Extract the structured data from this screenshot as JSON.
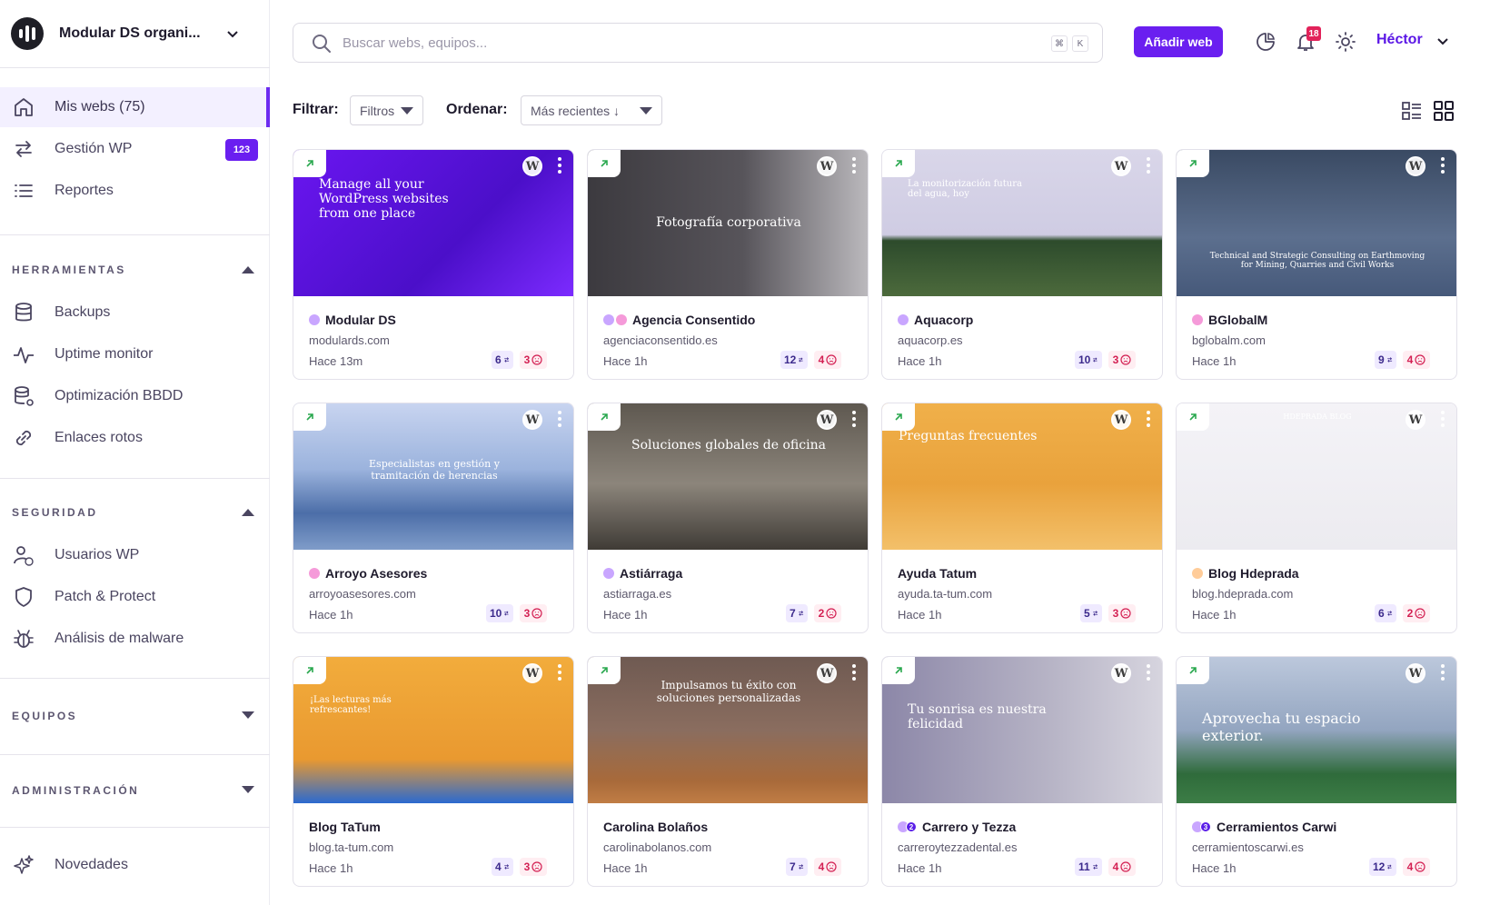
{
  "org": {
    "name": "Modular DS organi..."
  },
  "sidebar": {
    "main": [
      {
        "label": "Mis webs (75)",
        "icon": "home-icon",
        "active": true
      },
      {
        "label": "Gestión WP",
        "icon": "sync-icon",
        "badge": "123"
      },
      {
        "label": "Reportes",
        "icon": "list-icon"
      }
    ],
    "sections": [
      {
        "title": "HERRAMIENTAS",
        "expanded": true,
        "items": [
          {
            "label": "Backups",
            "icon": "database-icon"
          },
          {
            "label": "Uptime monitor",
            "icon": "pulse-icon"
          },
          {
            "label": "Optimización BBDD",
            "icon": "database-gear-icon"
          },
          {
            "label": "Enlaces rotos",
            "icon": "link-icon"
          }
        ]
      },
      {
        "title": "SEGURIDAD",
        "expanded": true,
        "items": [
          {
            "label": "Usuarios WP",
            "icon": "user-wp-icon"
          },
          {
            "label": "Patch & Protect",
            "icon": "shield-icon"
          },
          {
            "label": "Análisis de malware",
            "icon": "bug-icon"
          }
        ]
      },
      {
        "title": "EQUIPOS",
        "expanded": false
      },
      {
        "title": "ADMINISTRACIÓN",
        "expanded": false
      }
    ],
    "footer": {
      "label": "Novedades",
      "icon": "sparkles-icon"
    }
  },
  "topbar": {
    "search_placeholder": "Buscar webs, equipos...",
    "shortcut": [
      "⌘",
      "K"
    ],
    "add_button": "Añadir web",
    "notifications": "18",
    "user": "Héctor"
  },
  "filters": {
    "filter_label": "Filtrar:",
    "filter_value": "Filtros",
    "sort_label": "Ordenar:",
    "sort_value": "Más recientes ↓"
  },
  "sites": [
    {
      "name": "Modular DS",
      "domain": "modulards.com",
      "time": "Hace 13m",
      "updates": "6",
      "alerts": "3",
      "dot": "#c9a6ff",
      "headline": "Manage all your WordPress websites from one place",
      "theme": "purple"
    },
    {
      "name": "Agencia Consentido",
      "domain": "agenciaconsentido.es",
      "time": "Hace 1h",
      "updates": "12",
      "alerts": "4",
      "dot": "#c9a6ff",
      "dot2": "#f59ad9",
      "headline": "Fotografía corporativa",
      "theme": "photo"
    },
    {
      "name": "Aquacorp",
      "domain": "aquacorp.es",
      "time": "Hace 1h",
      "updates": "10",
      "alerts": "3",
      "dot": "#c9a6ff",
      "headline": "La monitorización futura del agua, hoy",
      "theme": "aqua"
    },
    {
      "name": "BGlobalM",
      "domain": "bglobalm.com",
      "time": "Hace 1h",
      "updates": "9",
      "alerts": "4",
      "dot": "#f59ad9",
      "headline": "Technical and Strategic Consulting on Earthmoving for Mining, Quarries and Civil Works",
      "theme": "rowing"
    },
    {
      "name": "Arroyo Asesores",
      "domain": "arroyoasesores.com",
      "time": "Hace 1h",
      "updates": "10",
      "alerts": "3",
      "dot": "#f59ad9",
      "headline": "Especialistas en gestión y tramitación de herencias",
      "theme": "mountains"
    },
    {
      "name": "Astiárraga",
      "domain": "astiarraga.es",
      "time": "Hace 1h",
      "updates": "7",
      "alerts": "2",
      "dot": "#c9a6ff",
      "headline": "Soluciones globales de oficina",
      "theme": "office"
    },
    {
      "name": "Ayuda Tatum",
      "domain": "ayuda.ta-tum.com",
      "time": "Hace 1h",
      "updates": "5",
      "alerts": "3",
      "dot": "",
      "headline": "Preguntas frecuentes",
      "theme": "faq"
    },
    {
      "name": "Blog Hdeprada",
      "domain": "blog.hdeprada.com",
      "time": "Hace 1h",
      "updates": "6",
      "alerts": "2",
      "dot": "#ffcc99",
      "headline": "HDEPRADA BLOG",
      "theme": "blog"
    },
    {
      "name": "Blog TaTum",
      "domain": "blog.ta-tum.com",
      "time": "Hace 1h",
      "updates": "4",
      "alerts": "3",
      "dot": "",
      "headline": "¡Las lecturas más refrescantes!",
      "theme": "tatum"
    },
    {
      "name": "Carolina Bolaños",
      "domain": "carolinabolanos.com",
      "time": "Hace 1h",
      "updates": "7",
      "alerts": "4",
      "dot": "",
      "headline": "Impulsamos tu éxito con soluciones personalizadas",
      "theme": "rocks"
    },
    {
      "name": "Carrero y Tezza",
      "domain": "carreroytezzadental.es",
      "time": "Hace 1h",
      "updates": "11",
      "alerts": "4",
      "dot": "#c9a6ff",
      "team": "2",
      "headline": "Tu sonrisa es nuestra felicidad",
      "theme": "dental"
    },
    {
      "name": "Cerramientos Carwi",
      "domain": "cerramientoscarwi.es",
      "time": "Hace 1h",
      "updates": "12",
      "alerts": "4",
      "dot": "#c9a6ff",
      "team": "3",
      "headline": "Aprovecha tu espacio exterior.",
      "theme": "house"
    }
  ]
}
